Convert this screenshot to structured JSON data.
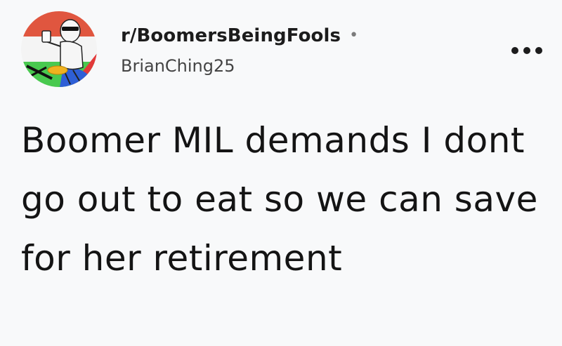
{
  "post": {
    "subreddit": "r/BoomersBeingFools",
    "separator": "•",
    "author": "BrianChing25",
    "title": "Boomer MIL demands I dont go out to eat so we can save for her retirement"
  },
  "icons": {
    "avatar": "subreddit-avatar-icon",
    "more": "more-options-icon"
  },
  "colors": {
    "background": "#f8f9fa",
    "text": "#1a1a1b",
    "muted": "#7c7c7c"
  }
}
